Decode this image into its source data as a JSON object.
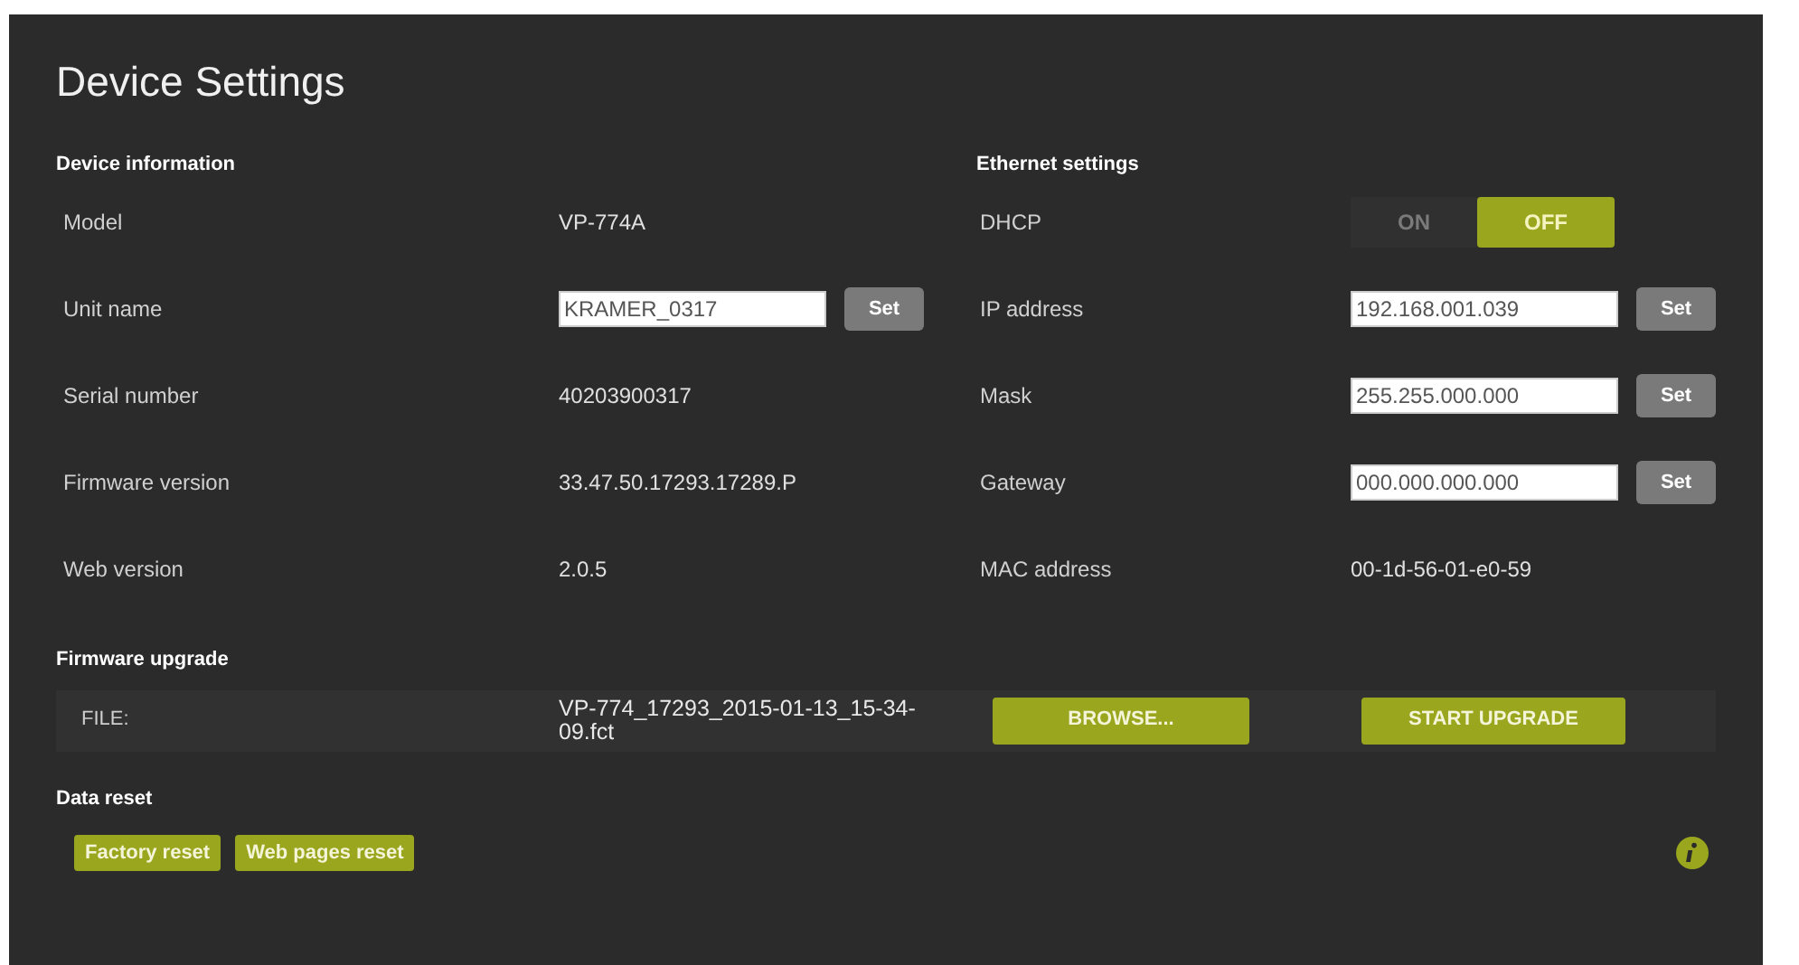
{
  "title": "Device Settings",
  "device_information": {
    "heading": "Device information",
    "rows": [
      {
        "kind": "text",
        "label": "Model",
        "value": "VP-774A"
      },
      {
        "kind": "input",
        "label": "Unit name",
        "value": "KRAMER_0317",
        "button": "Set"
      },
      {
        "kind": "text",
        "label": "Serial number",
        "value": "40203900317"
      },
      {
        "kind": "text",
        "label": "Firmware version",
        "value": "33.47.50.17293.17289.P"
      },
      {
        "kind": "text",
        "label": "Web version",
        "value": "2.0.5"
      }
    ]
  },
  "ethernet_settings": {
    "heading": "Ethernet settings",
    "rows": [
      {
        "kind": "toggle",
        "label": "DHCP",
        "options": [
          {
            "label": "ON",
            "selected": false
          },
          {
            "label": "OFF",
            "selected": true
          }
        ]
      },
      {
        "kind": "input",
        "label": "IP address",
        "value": "192.168.001.039",
        "button": "Set"
      },
      {
        "kind": "input",
        "label": "Mask",
        "value": "255.255.000.000",
        "button": "Set"
      },
      {
        "kind": "input",
        "label": "Gateway",
        "value": "000.000.000.000",
        "button": "Set"
      },
      {
        "kind": "text",
        "label": "MAC address",
        "value": "00-1d-56-01-e0-59"
      }
    ]
  },
  "firmware_upgrade": {
    "heading": "Firmware upgrade",
    "file_label": "FILE:",
    "file_name": "VP-774_17293_2015-01-13_15-34-09.fct",
    "browse_button": "BROWSE...",
    "upgrade_button": "START UPGRADE"
  },
  "data_reset": {
    "heading": "Data reset",
    "buttons": [
      "Factory reset",
      "Web pages reset"
    ]
  }
}
